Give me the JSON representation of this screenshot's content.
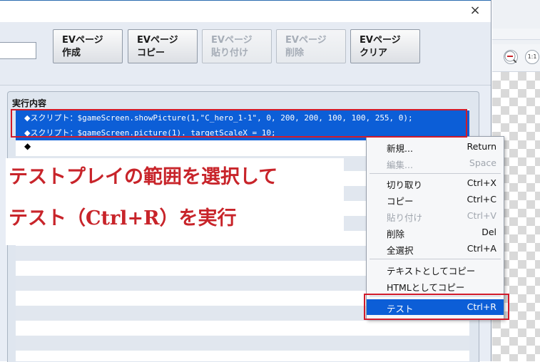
{
  "dialog": {
    "close_glyph": "×",
    "ev_buttons": [
      {
        "line1": "EVページ",
        "line2": "作成",
        "disabled": false
      },
      {
        "line1": "EVページ",
        "line2": "コピー",
        "disabled": false
      },
      {
        "line1": "EVページ",
        "line2": "貼り付け",
        "disabled": true
      },
      {
        "line1": "EVページ",
        "line2": "削除",
        "disabled": true
      },
      {
        "line1": "EVページ",
        "line2": "クリア",
        "disabled": false
      }
    ],
    "content_label": "実行内容",
    "rows": [
      {
        "cmd": "◆スクリプト：",
        "code": "$gameScreen.showPicture(1,\"C_hero_1-1\", 0, 200, 200, 100, 100, 255, 0);"
      },
      {
        "cmd": "◆スクリプト：",
        "code": "$gameScreen.picture(1)._targetScaleX = 10;"
      }
    ],
    "empty_row_marker": "◆"
  },
  "annotation": {
    "line1": "テストプレイの範囲を選択して",
    "line2": "テスト（Ctrl+R）を実行",
    "color": "#c8242a"
  },
  "context_menu": {
    "items": [
      {
        "label": "新規...",
        "shortcut": "Return",
        "disabled": false
      },
      {
        "label": "編集...",
        "shortcut": "Space",
        "disabled": true
      },
      {
        "label": "切り取り",
        "shortcut": "Ctrl+X",
        "disabled": false
      },
      {
        "label": "コピー",
        "shortcut": "Ctrl+C",
        "disabled": false
      },
      {
        "label": "貼り付け",
        "shortcut": "Ctrl+V",
        "disabled": true
      },
      {
        "label": "削除",
        "shortcut": "Del",
        "disabled": false
      },
      {
        "label": "全選択",
        "shortcut": "Ctrl+A",
        "disabled": false
      },
      {
        "label": "テキストとしてコピー",
        "shortcut": "",
        "disabled": false
      },
      {
        "label": "HTMLとしてコピー",
        "shortcut": "",
        "disabled": false
      },
      {
        "label": "テスト",
        "shortcut": "Ctrl+R",
        "disabled": false,
        "active": true
      }
    ]
  },
  "editor": {
    "zoom_out_icon": "zoom-out-icon",
    "zoom_reset_label": "1:1"
  },
  "colors": {
    "selection": "#0c5ed7",
    "highlight_border": "#d11a2a"
  }
}
